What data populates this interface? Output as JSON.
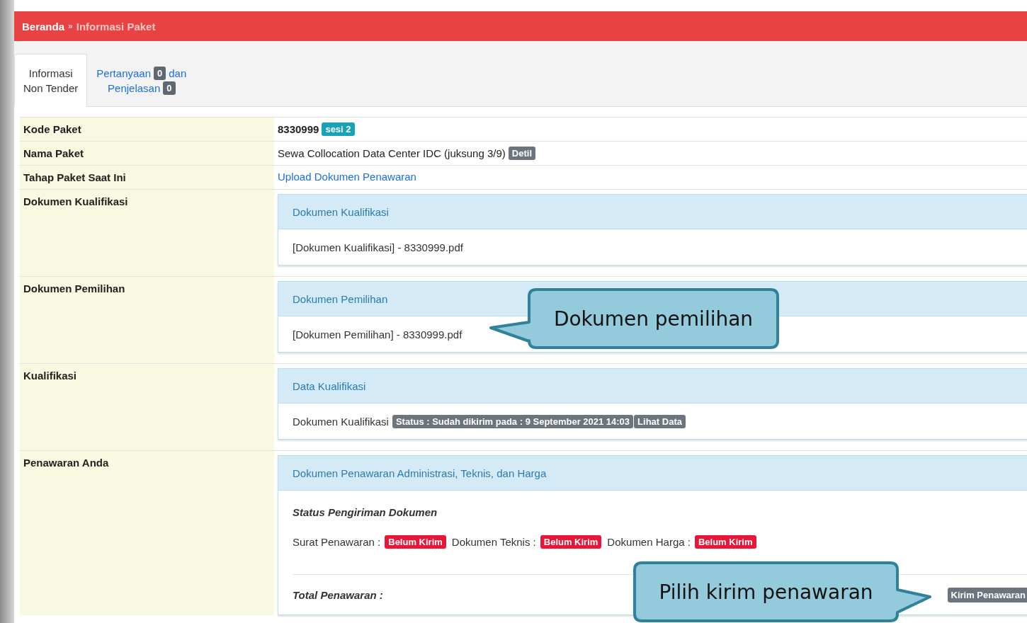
{
  "breadcrumb": {
    "items": [
      {
        "label": "Beranda",
        "current": false
      },
      {
        "label": "Informasi Paket",
        "current": true
      }
    ],
    "separator": "»"
  },
  "tabs": [
    {
      "selected": true,
      "parts": [
        {
          "kind": "text",
          "text": "Informasi"
        },
        {
          "kind": "break"
        },
        {
          "kind": "text",
          "text": "Non Tender"
        }
      ]
    },
    {
      "selected": false,
      "parts": [
        {
          "kind": "text",
          "text": "Pertanyaan"
        },
        {
          "kind": "badge",
          "text": "0"
        },
        {
          "kind": "text",
          "text": "dan"
        },
        {
          "kind": "break"
        },
        {
          "kind": "text",
          "text": "Penjelasan"
        },
        {
          "kind": "badge",
          "text": "0"
        }
      ]
    }
  ],
  "rows": [
    {
      "label": "Kode Paket",
      "kind": "plain",
      "value": "8330999",
      "strong": true,
      "badge": {
        "text": "sesi 2",
        "kind": "info"
      }
    },
    {
      "label": "Nama Paket",
      "kind": "plain",
      "value": "Sewa Collocation Data Center IDC (juksung 3/9)",
      "strong": false,
      "badge": {
        "text": "Detil",
        "kind": "secondary"
      }
    },
    {
      "label": "Tahap Paket Saat Ini",
      "kind": "link",
      "value": "Upload Dokumen Penawaran"
    },
    {
      "label": "Dokumen Kualifikasi",
      "kind": "panel",
      "heading": "Dokumen Kualifikasi",
      "body": {
        "kind": "file",
        "text": "[Dokumen Kualifikasi] - 8330999.pdf"
      }
    },
    {
      "label": "Dokumen Pemilihan",
      "kind": "panel",
      "heading": "Dokumen Pemilihan",
      "body": {
        "kind": "file",
        "text": "[Dokumen Pemilihan] - 8330999.pdf"
      }
    },
    {
      "label": "Kualifikasi",
      "kind": "panel",
      "heading": "Data Kualifikasi",
      "body": {
        "kind": "status",
        "text": "Dokumen Kualifikasi",
        "status": "Status : Sudah dikirim pada : 9 September 2021 14:03",
        "action": "Lihat Data"
      }
    },
    {
      "label": "Penawaran Anda",
      "kind": "panel",
      "heading": "Dokumen Penawaran Administrasi, Teknis, dan Harga",
      "body": {
        "kind": "offer",
        "subtitle": "Status Pengiriman Dokumen",
        "items": [
          {
            "label": "Surat Penawaran :",
            "status": "Belum Kirim",
            "sent": false
          },
          {
            "label": "Dokumen Teknis :",
            "status": "Belum Kirim",
            "sent": false
          },
          {
            "label": "Dokumen Harga :",
            "status": "Belum Kirim",
            "sent": false
          }
        ],
        "total_label": "Total Penawaran :",
        "button": "Kirim Penawaran"
      }
    }
  ],
  "callouts": [
    {
      "text": "Dokumen pemilihan",
      "kind": "left"
    },
    {
      "text": "Pilih kirim penawaran",
      "kind": "right"
    }
  ]
}
